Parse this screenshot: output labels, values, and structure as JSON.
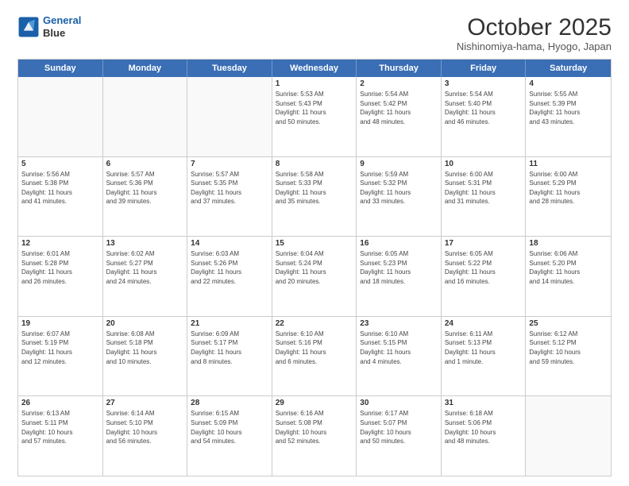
{
  "logo": {
    "line1": "General",
    "line2": "Blue"
  },
  "header": {
    "month": "October 2025",
    "location": "Nishinomiya-hama, Hyogo, Japan"
  },
  "weekdays": [
    "Sunday",
    "Monday",
    "Tuesday",
    "Wednesday",
    "Thursday",
    "Friday",
    "Saturday"
  ],
  "weeks": [
    [
      {
        "day": "",
        "text": ""
      },
      {
        "day": "",
        "text": ""
      },
      {
        "day": "",
        "text": ""
      },
      {
        "day": "1",
        "text": "Sunrise: 5:53 AM\nSunset: 5:43 PM\nDaylight: 11 hours\nand 50 minutes."
      },
      {
        "day": "2",
        "text": "Sunrise: 5:54 AM\nSunset: 5:42 PM\nDaylight: 11 hours\nand 48 minutes."
      },
      {
        "day": "3",
        "text": "Sunrise: 5:54 AM\nSunset: 5:40 PM\nDaylight: 11 hours\nand 46 minutes."
      },
      {
        "day": "4",
        "text": "Sunrise: 5:55 AM\nSunset: 5:39 PM\nDaylight: 11 hours\nand 43 minutes."
      }
    ],
    [
      {
        "day": "5",
        "text": "Sunrise: 5:56 AM\nSunset: 5:38 PM\nDaylight: 11 hours\nand 41 minutes."
      },
      {
        "day": "6",
        "text": "Sunrise: 5:57 AM\nSunset: 5:36 PM\nDaylight: 11 hours\nand 39 minutes."
      },
      {
        "day": "7",
        "text": "Sunrise: 5:57 AM\nSunset: 5:35 PM\nDaylight: 11 hours\nand 37 minutes."
      },
      {
        "day": "8",
        "text": "Sunrise: 5:58 AM\nSunset: 5:33 PM\nDaylight: 11 hours\nand 35 minutes."
      },
      {
        "day": "9",
        "text": "Sunrise: 5:59 AM\nSunset: 5:32 PM\nDaylight: 11 hours\nand 33 minutes."
      },
      {
        "day": "10",
        "text": "Sunrise: 6:00 AM\nSunset: 5:31 PM\nDaylight: 11 hours\nand 31 minutes."
      },
      {
        "day": "11",
        "text": "Sunrise: 6:00 AM\nSunset: 5:29 PM\nDaylight: 11 hours\nand 28 minutes."
      }
    ],
    [
      {
        "day": "12",
        "text": "Sunrise: 6:01 AM\nSunset: 5:28 PM\nDaylight: 11 hours\nand 26 minutes."
      },
      {
        "day": "13",
        "text": "Sunrise: 6:02 AM\nSunset: 5:27 PM\nDaylight: 11 hours\nand 24 minutes."
      },
      {
        "day": "14",
        "text": "Sunrise: 6:03 AM\nSunset: 5:26 PM\nDaylight: 11 hours\nand 22 minutes."
      },
      {
        "day": "15",
        "text": "Sunrise: 6:04 AM\nSunset: 5:24 PM\nDaylight: 11 hours\nand 20 minutes."
      },
      {
        "day": "16",
        "text": "Sunrise: 6:05 AM\nSunset: 5:23 PM\nDaylight: 11 hours\nand 18 minutes."
      },
      {
        "day": "17",
        "text": "Sunrise: 6:05 AM\nSunset: 5:22 PM\nDaylight: 11 hours\nand 16 minutes."
      },
      {
        "day": "18",
        "text": "Sunrise: 6:06 AM\nSunset: 5:20 PM\nDaylight: 11 hours\nand 14 minutes."
      }
    ],
    [
      {
        "day": "19",
        "text": "Sunrise: 6:07 AM\nSunset: 5:19 PM\nDaylight: 11 hours\nand 12 minutes."
      },
      {
        "day": "20",
        "text": "Sunrise: 6:08 AM\nSunset: 5:18 PM\nDaylight: 11 hours\nand 10 minutes."
      },
      {
        "day": "21",
        "text": "Sunrise: 6:09 AM\nSunset: 5:17 PM\nDaylight: 11 hours\nand 8 minutes."
      },
      {
        "day": "22",
        "text": "Sunrise: 6:10 AM\nSunset: 5:16 PM\nDaylight: 11 hours\nand 6 minutes."
      },
      {
        "day": "23",
        "text": "Sunrise: 6:10 AM\nSunset: 5:15 PM\nDaylight: 11 hours\nand 4 minutes."
      },
      {
        "day": "24",
        "text": "Sunrise: 6:11 AM\nSunset: 5:13 PM\nDaylight: 11 hours\nand 1 minute."
      },
      {
        "day": "25",
        "text": "Sunrise: 6:12 AM\nSunset: 5:12 PM\nDaylight: 10 hours\nand 59 minutes."
      }
    ],
    [
      {
        "day": "26",
        "text": "Sunrise: 6:13 AM\nSunset: 5:11 PM\nDaylight: 10 hours\nand 57 minutes."
      },
      {
        "day": "27",
        "text": "Sunrise: 6:14 AM\nSunset: 5:10 PM\nDaylight: 10 hours\nand 56 minutes."
      },
      {
        "day": "28",
        "text": "Sunrise: 6:15 AM\nSunset: 5:09 PM\nDaylight: 10 hours\nand 54 minutes."
      },
      {
        "day": "29",
        "text": "Sunrise: 6:16 AM\nSunset: 5:08 PM\nDaylight: 10 hours\nand 52 minutes."
      },
      {
        "day": "30",
        "text": "Sunrise: 6:17 AM\nSunset: 5:07 PM\nDaylight: 10 hours\nand 50 minutes."
      },
      {
        "day": "31",
        "text": "Sunrise: 6:18 AM\nSunset: 5:06 PM\nDaylight: 10 hours\nand 48 minutes."
      },
      {
        "day": "",
        "text": ""
      }
    ]
  ]
}
